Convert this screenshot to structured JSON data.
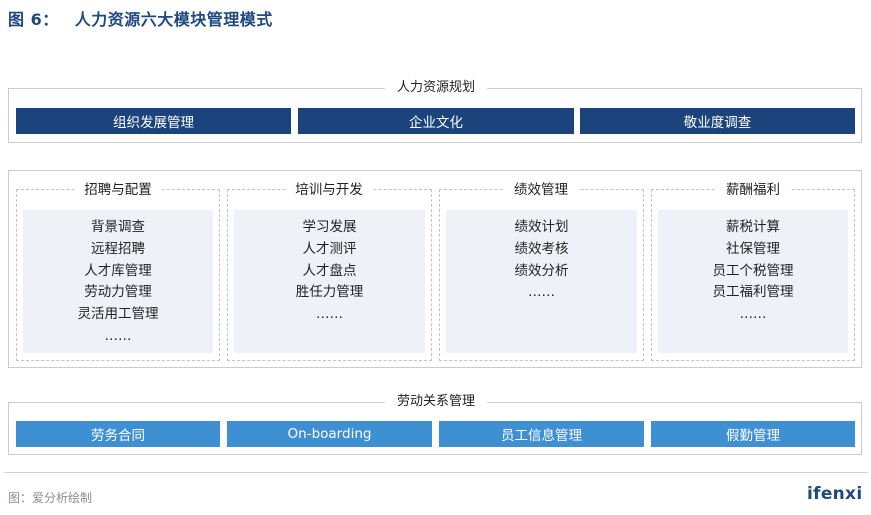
{
  "title": {
    "prefix": "图 6：",
    "text": "人力资源六大模块管理模式"
  },
  "planning": {
    "label": "人力资源规划",
    "items": [
      "组织发展管理",
      "企业文化",
      "敬业度调查"
    ]
  },
  "modules": [
    {
      "title": "招聘与配置",
      "items": [
        "背景调查",
        "远程招聘",
        "人才库管理",
        "劳动力管理",
        "灵活用工管理",
        "……"
      ]
    },
    {
      "title": "培训与开发",
      "items": [
        "学习发展",
        "人才测评",
        "人才盘点",
        "胜任力管理",
        "……"
      ]
    },
    {
      "title": "绩效管理",
      "items": [
        "绩效计划",
        "绩效考核",
        "绩效分析",
        "……"
      ]
    },
    {
      "title": "薪酬福利",
      "items": [
        "薪税计算",
        "社保管理",
        "员工个税管理",
        "员工福利管理",
        "……"
      ]
    }
  ],
  "labor": {
    "label": "劳动关系管理",
    "items": [
      "劳务合同",
      "On-boarding",
      "员工信息管理",
      "假勤管理"
    ]
  },
  "footer": {
    "source": "图：爱分析绘制",
    "logo": "ifenxi"
  },
  "colors": {
    "dark_bar": "#1b437c",
    "light_bar": "#3f8fd3",
    "panel": "#eef2f8",
    "title": "#1f4a80"
  }
}
